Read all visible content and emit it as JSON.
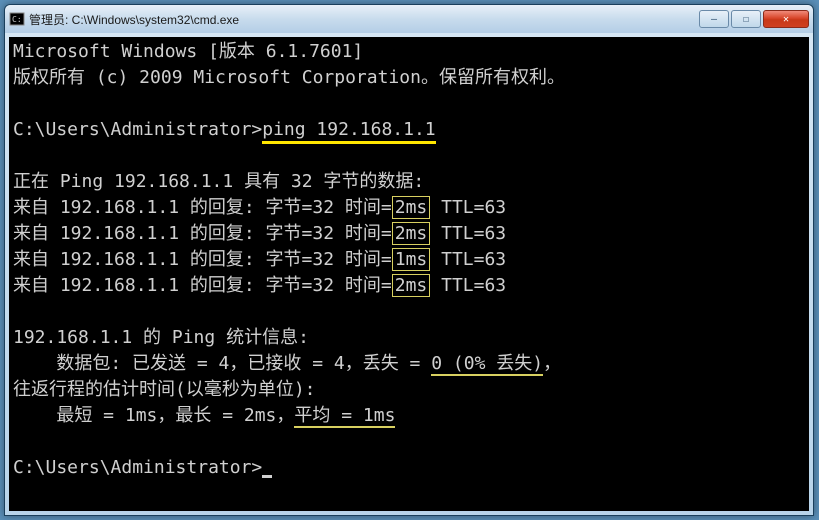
{
  "window": {
    "title": "管理员: C:\\Windows\\system32\\cmd.exe",
    "icon_label": "cmd-icon",
    "buttons": {
      "min": "—",
      "max": "☐",
      "close": "✕"
    }
  },
  "terminal": {
    "header_line1": "Microsoft Windows [版本 6.1.7601]",
    "header_line2": "版权所有 (c) 2009 Microsoft Corporation。保留所有权利。",
    "prompt1_path": "C:\\Users\\Administrator>",
    "command": "ping 192.168.1.1",
    "ping_header": "正在 Ping 192.168.1.1 具有 32 字节的数据:",
    "replies": [
      {
        "prefix": "来自 192.168.1.1 的回复: 字节=32 时间=",
        "time": "2ms",
        "suffix": " TTL=63"
      },
      {
        "prefix": "来自 192.168.1.1 的回复: 字节=32 时间=",
        "time": "2ms",
        "suffix": " TTL=63"
      },
      {
        "prefix": "来自 192.168.1.1 的回复: 字节=32 时间=",
        "time": "1ms",
        "suffix": " TTL=63"
      },
      {
        "prefix": "来自 192.168.1.1 的回复: 字节=32 时间=",
        "time": "2ms",
        "suffix": " TTL=63"
      }
    ],
    "stats_header": "192.168.1.1 的 Ping 统计信息:",
    "packets_prefix": "    数据包: 已发送 = 4，已接收 = 4，丢失 = ",
    "packets_loss": "0 (0% 丢失)",
    "packets_tail": "，",
    "rtt_header": "往返行程的估计时间(以毫秒为单位):",
    "rtt_prefix": "    最短 = 1ms，最长 = 2ms，",
    "rtt_avg": "平均 = 1ms",
    "prompt2_path": "C:\\Users\\Administrator>"
  }
}
